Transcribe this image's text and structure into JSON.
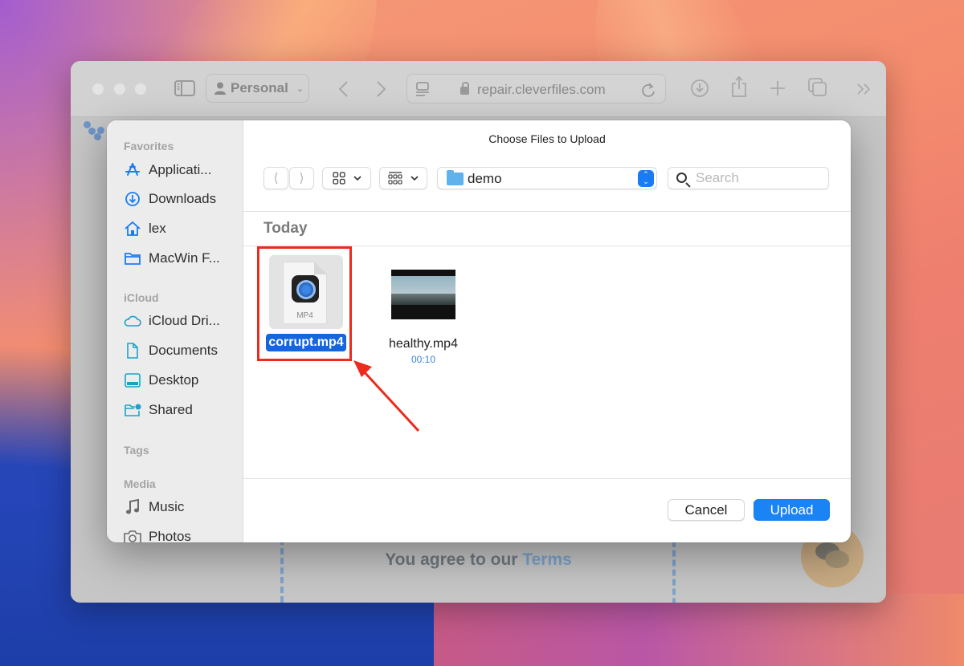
{
  "browser": {
    "profile_label": "Personal",
    "url": "repair.cleverfiles.com",
    "icons": [
      "sidebar-toggle-icon",
      "person-icon",
      "back-icon",
      "forward-icon",
      "reader-icon",
      "lock-icon",
      "reload-icon",
      "download-icon",
      "share-icon",
      "new-tab-icon",
      "tabs-overview-icon",
      "more-icon"
    ]
  },
  "page": {
    "agree_prefix": "You agree to our ",
    "agree_link": "Terms"
  },
  "dialog": {
    "title": "Choose Files to Upload",
    "location": "demo",
    "search_placeholder": "Search",
    "group_label": "Today",
    "cancel_label": "Cancel",
    "upload_label": "Upload",
    "sidebar": {
      "sections": [
        {
          "heading": "Favorites",
          "items": [
            {
              "label": "Applicati...",
              "icon": "applications-icon"
            },
            {
              "label": "Downloads",
              "icon": "downloads-icon"
            },
            {
              "label": "lex",
              "icon": "home-icon"
            },
            {
              "label": "MacWin F...",
              "icon": "folder-icon"
            }
          ]
        },
        {
          "heading": "iCloud",
          "items": [
            {
              "label": "iCloud Dri...",
              "icon": "cloud-icon"
            },
            {
              "label": "Documents",
              "icon": "document-icon"
            },
            {
              "label": "Desktop",
              "icon": "desktop-icon"
            },
            {
              "label": "Shared",
              "icon": "shared-folder-icon"
            }
          ]
        },
        {
          "heading": "Tags",
          "items": []
        },
        {
          "heading": "Media",
          "items": [
            {
              "label": "Music",
              "icon": "music-icon"
            },
            {
              "label": "Photos",
              "icon": "camera-icon"
            }
          ]
        }
      ]
    },
    "files": [
      {
        "name": "corrupt.mp4",
        "type_label": "MP4",
        "selected": true,
        "duration": ""
      },
      {
        "name": "healthy.mp4",
        "type_label": "",
        "selected": false,
        "duration": "00:10"
      }
    ]
  },
  "annotation": {
    "highlight_color": "#ec2a1d",
    "target": "corrupt.mp4"
  },
  "colors": {
    "accent": "#1a84f5",
    "selection": "#1565de",
    "duration_text": "#3b82e0"
  }
}
